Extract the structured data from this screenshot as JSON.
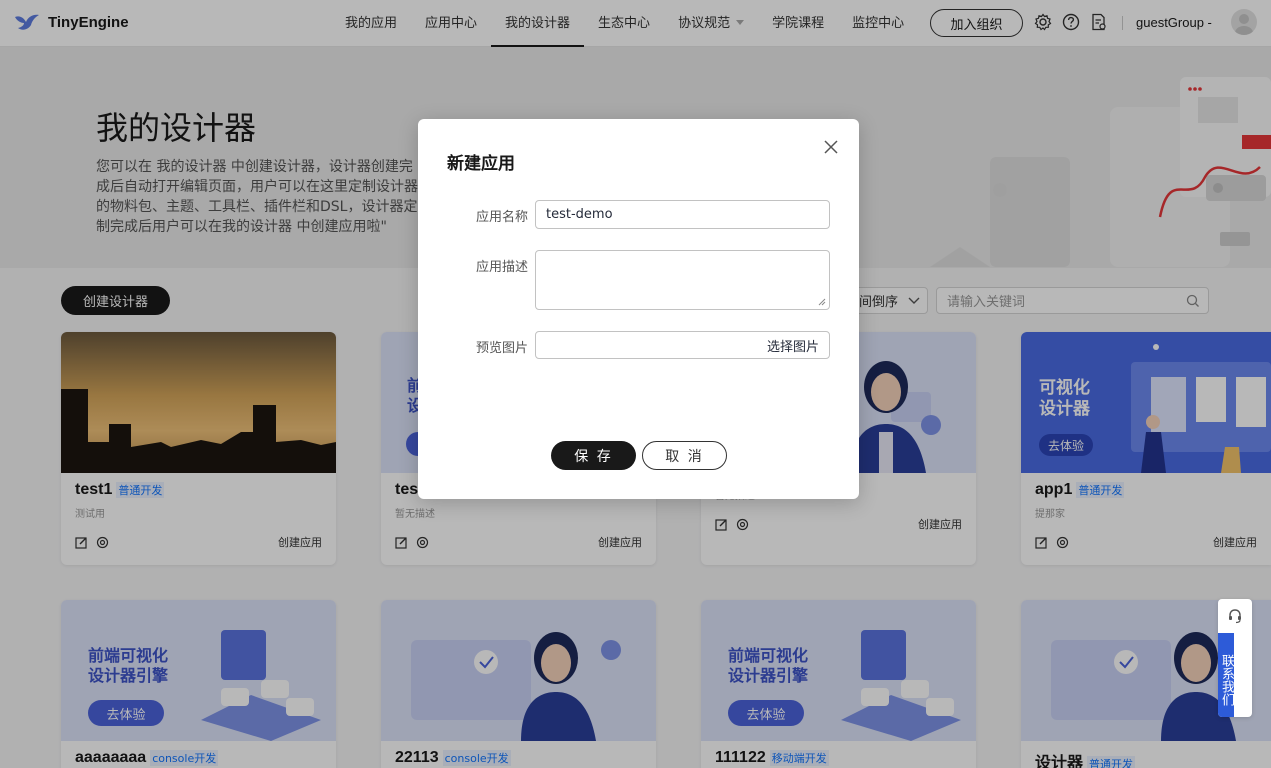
{
  "header": {
    "brand": "TinyEngine",
    "nav": [
      {
        "label": "我的应用",
        "active": false
      },
      {
        "label": "应用中心",
        "active": false
      },
      {
        "label": "我的设计器",
        "active": true
      },
      {
        "label": "生态中心",
        "active": false
      },
      {
        "label": "协议规范",
        "active": false,
        "has_dropdown": true
      },
      {
        "label": "学院课程",
        "active": false
      },
      {
        "label": "监控中心",
        "active": false
      }
    ],
    "join_label": "加入组织",
    "user": "guestGroup -",
    "icons": [
      "gear-icon",
      "help-icon",
      "document-icon",
      "avatar"
    ]
  },
  "banner": {
    "title": "我的设计器",
    "description": "您可以在 我的设计器 中创建设计器，设计器创建完成后自动打开编辑页面，用户可以在这里定制设计器的物料包、主题、工具栏、插件栏和DSL，设计器定制完成后用户可以在我的设计器 中创建应用啦\""
  },
  "toolbar": {
    "create_label": "创建设计器",
    "sort_label": "间倒序",
    "search_placeholder": "请输入关键词"
  },
  "cards": [
    {
      "title": "test1",
      "tag": "普通开发",
      "desc": "测试用",
      "action": "创建应用",
      "thumb": "city"
    },
    {
      "title": "tes",
      "tag": "",
      "desc": "暂无描述",
      "action": "创建应用",
      "thumb": "promo"
    },
    {
      "title": "",
      "tag": "",
      "desc": "暂无描述",
      "action": "创建应用",
      "thumb": "girl"
    },
    {
      "title": "app1",
      "tag": "普通开发",
      "desc": "提那家",
      "action": "创建应用",
      "thumb": "visual"
    },
    {
      "title": "aaaaaaaa",
      "tag": "console开发",
      "thumb": "engine"
    },
    {
      "title": "22113",
      "tag": "console开发",
      "thumb": "girl"
    },
    {
      "title": "111122",
      "tag": "移动端开发",
      "thumb": "engine"
    },
    {
      "title": "设计器",
      "tag": "普通开发",
      "thumb": "girl"
    }
  ],
  "thumb_text": {
    "promo_short": "前\n设",
    "visual_line1": "可视化",
    "visual_line2": "设计器",
    "visual_button": "去体验",
    "engine_line1": "前端可视化",
    "engine_line2": "设计器引擎",
    "engine_button": "去体验"
  },
  "modal": {
    "title": "新建应用",
    "name_label": "应用名称",
    "name_value": "test-demo",
    "desc_label": "应用描述",
    "desc_value": "",
    "image_label": "预览图片",
    "image_button": "选择图片",
    "save_label": "保 存",
    "cancel_label": "取 消"
  },
  "contact": {
    "label": "联系我们"
  },
  "colors": {
    "accent": "#191919",
    "tag_blue": "#1476ff",
    "promo_blue": "#5a73e0"
  }
}
